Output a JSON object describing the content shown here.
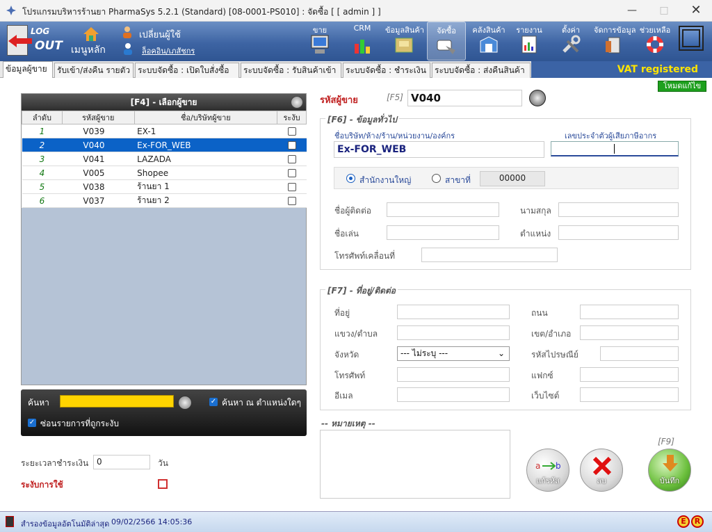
{
  "window": {
    "title": "โปรแกรมบริหารร้านยา PharmaSys 5.2.1 (Standard) [08-0001-PS010] : จัดซื้อ  [ [ admin ] ]"
  },
  "toolbar": {
    "logout_top": "LOG",
    "logout_bottom": "OUT",
    "main_menu": "เมนูหลัก",
    "change_user": "เปลี่ยนผู้ใช้",
    "login_history": "ล็อคอิน/เภสัชกร",
    "items": [
      "ขาย",
      "CRM",
      "ข้อมูลสินค้า",
      "จัดซื้อ",
      "คลังสินค้า",
      "รายงาน",
      "ตั้งค่า",
      "จัดการข้อมูล",
      "ช่วยเหลือ"
    ]
  },
  "tabs": [
    "ข้อมูลผู้ขาย",
    "รับเข้า/ส่งคืน รายตัว",
    "ระบบจัดซื้อ : เปิดใบสั่งซื้อ",
    "ระบบจัดซื้อ : รับสินค้าเข้า",
    "ระบบจัดซื้อ : ชำระเงิน",
    "ระบบจัดซื้อ : ส่งคืนสินค้า"
  ],
  "vat": "VAT registered",
  "edit_mode": "โหมดแก้ไข",
  "vendor_list": {
    "title": "[F4] - เลือกผู้ขาย",
    "columns": [
      "ลำดับ",
      "รหัสผู้ขาย",
      "ชื่อ/บริษัทผู้ขาย",
      "ระงับ"
    ],
    "rows": [
      {
        "no": "1",
        "code": "V039",
        "name": "EX-1"
      },
      {
        "no": "2",
        "code": "V040",
        "name": "Ex-FOR_WEB"
      },
      {
        "no": "3",
        "code": "V041",
        "name": "LAZADA"
      },
      {
        "no": "4",
        "code": "V005",
        "name": "Shopee"
      },
      {
        "no": "5",
        "code": "V038",
        "name": "ร้านยา 1"
      },
      {
        "no": "6",
        "code": "V037",
        "name": "ร้านยา 2"
      }
    ]
  },
  "search": {
    "label": "ค้นหา",
    "any_position": "ค้นหา ณ ตำแหน่งใดๆ",
    "hide_suspended": "ซ่อนรายการที่ถูกระงับ"
  },
  "payment": {
    "label": "ระยะเวลาชำระเงิน",
    "value": "0",
    "unit": "วัน"
  },
  "suspend_label": "ระงับการใช้",
  "vendor_code": {
    "label": "รหัสผู้ขาย",
    "key": "[F5]",
    "value": "V040"
  },
  "general": {
    "title": "[F6] - ข้อมูลทั่วไป",
    "company_label": "ชื่อบริษัท/ห้าง/ร้าน/หน่วยงาน/องค์กร",
    "company_value": "Ex-FOR_WEB",
    "tax_label": "เลขประจำตัวผู้เสียภาษีอากร",
    "head_office": "สำนักงานใหญ่",
    "branch": "สาขาที่",
    "branch_no": "00000",
    "contact": "ชื่อผู้ติดต่อ",
    "surname": "นามสกุล",
    "nickname": "ชื่อเล่น",
    "position": "ตำแหน่ง",
    "mobile": "โทรศัพท์เคลื่อนที่"
  },
  "address": {
    "title": "[F7] - ที่อยู่/ติดต่อ",
    "addr": "ที่อยู่",
    "road": "ถนน",
    "subdistrict": "แขวง/ตำบล",
    "district": "เขต/อำเภอ",
    "province": "จังหวัด",
    "province_value": "--- ไม่ระบุ ---",
    "postcode": "รหัสไปรษณีย์",
    "phone": "โทรศัพท์",
    "fax": "แฟกซ์",
    "email": "อีเมล",
    "website": "เว็บไซต์"
  },
  "remark": "-- หมายเหตุ --",
  "buttons": {
    "f9": "[F9]",
    "rename": "แก้รหัส",
    "delete": "ลบ",
    "save": "บันทึก"
  },
  "status": {
    "text": "สำรองข้อมูลอัตโนมัติล่าสุด",
    "datetime": "09/02/2566 14:05:36"
  }
}
